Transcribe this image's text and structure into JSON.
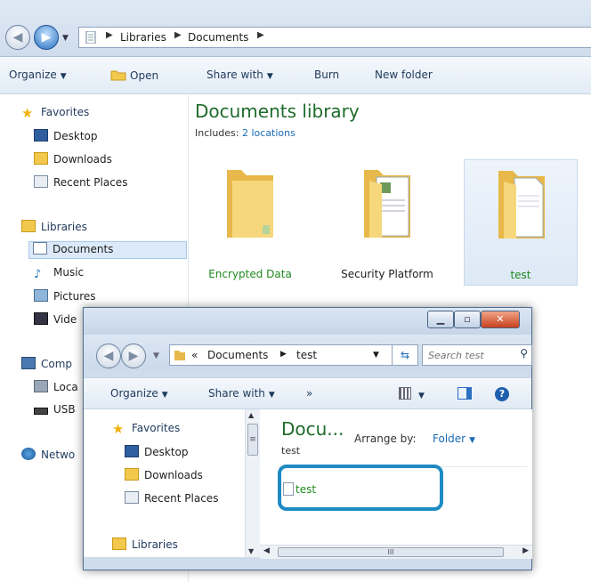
{
  "back_window": {
    "breadcrumb": [
      "Libraries",
      "Documents"
    ],
    "toolbar": {
      "organize": "Organize",
      "open": "Open",
      "share_with": "Share with",
      "burn": "Burn",
      "new_folder": "New folder"
    },
    "nav": {
      "favorites": "Favorites",
      "desktop": "Desktop",
      "downloads": "Downloads",
      "recent_places": "Recent Places",
      "libraries": "Libraries",
      "documents": "Documents",
      "music": "Music",
      "pictures": "Pictures",
      "videos": "Vide",
      "computer": "Comp",
      "local_disk": "Loca",
      "usb": "USB",
      "network": "Netwo"
    },
    "library_title": "Documents library",
    "includes_label": "Includes:",
    "includes_link": "2 locations",
    "items": [
      {
        "name": "Encrypted Data"
      },
      {
        "name": "Security Platform"
      },
      {
        "name": "test"
      }
    ]
  },
  "dialog": {
    "breadcrumb_prefix": "«",
    "breadcrumb": [
      "Documents",
      "test"
    ],
    "search_placeholder": "Search test",
    "toolbar": {
      "organize": "Organize",
      "share_with": "Share with",
      "more": "»"
    },
    "nav": {
      "favorites": "Favorites",
      "desktop": "Desktop",
      "downloads": "Downloads",
      "recent_places": "Recent Places",
      "libraries": "Libraries"
    },
    "header_title": "Docu...",
    "header_sub": "test",
    "arrange_label": "Arrange by:",
    "arrange_value": "Folder",
    "file_name": "test",
    "scroll_grip": "≡",
    "scroll_mid": "III"
  },
  "colors": {
    "library_title": "#1e6b2b",
    "highlight": "#1e8bc3",
    "green_caption": "#1f8a1f"
  }
}
